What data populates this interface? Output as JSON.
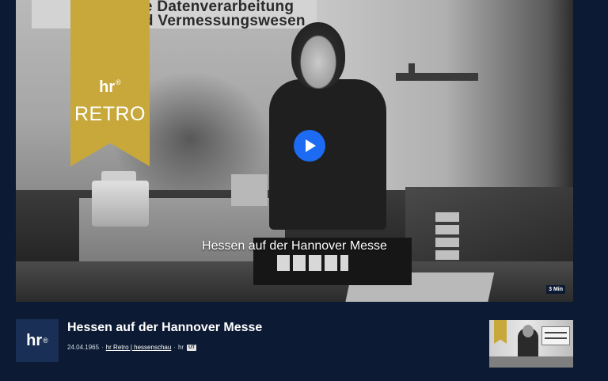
{
  "video": {
    "wall_text_line1": "ne Datenverarbeitung",
    "wall_text_line2": "nd Vermessungswesen",
    "badge_logo": "hr",
    "badge_logo_mark": "®",
    "badge_title": "RETRO",
    "caption": "Hessen auf der Hannover Messe",
    "duration": "3 Min"
  },
  "info": {
    "channel_logo": "hr",
    "channel_logo_mark": "®",
    "title": "Hessen auf der Hannover Messe",
    "date": "24.04.1965",
    "source_link": "hr Retro | hessenschau",
    "channel": "hr",
    "subtitle_badge": "UT"
  },
  "colors": {
    "background": "#0c1a33",
    "play_button": "#1c6bf2",
    "badge": "#c8a83a"
  },
  "icons": {
    "play": "play-icon"
  }
}
